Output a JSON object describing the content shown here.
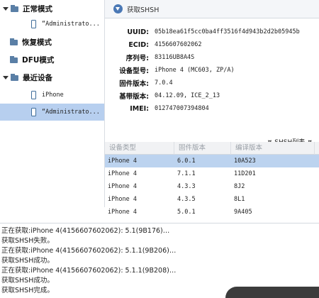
{
  "tree": {
    "items": [
      {
        "label": "正常模式",
        "kind": "folder"
      },
      {
        "label": "“Administrato...",
        "kind": "device"
      },
      {
        "label": "恢复模式",
        "kind": "folder"
      },
      {
        "label": "DFU模式",
        "kind": "folder"
      },
      {
        "label": "最近设备",
        "kind": "folder"
      },
      {
        "label": "iPhone",
        "kind": "device"
      },
      {
        "label": "“Administrato...",
        "kind": "device",
        "selected": true
      }
    ]
  },
  "toolbar": {
    "get_shsh_label": "获取SHSH"
  },
  "info": {
    "rows": [
      {
        "label": "UUID:",
        "value": "05b18ea61f5cc0ba4ff3516f4d943b2d2b05945b"
      },
      {
        "label": "ECID:",
        "value": "4156607602062"
      },
      {
        "label": "序列号:",
        "value": "83116UB8A4S"
      },
      {
        "label": "设备型号:",
        "value": "iPhone 4 (MC603, ZP/A)"
      },
      {
        "label": "固件版本:",
        "value": "7.0.4"
      },
      {
        "label": "基带版本:",
        "value": "04.12.09, ICE_2_13"
      },
      {
        "label": "IMEI:",
        "value": "012747007394804"
      }
    ],
    "shsh_list_label": "SHSH列表"
  },
  "table": {
    "columns": [
      "设备类型",
      "固件版本",
      "编译版本"
    ],
    "rows": [
      {
        "device": "iPhone 4",
        "firmware": "6.0.1",
        "build": "10A523",
        "selected": true
      },
      {
        "device": "iPhone 4",
        "firmware": "7.1.1",
        "build": "11D201"
      },
      {
        "device": "iPhone 4",
        "firmware": "4.3.3",
        "build": "8J2"
      },
      {
        "device": "iPhone 4",
        "firmware": "4.3.5",
        "build": "8L1"
      },
      {
        "device": "iPhone 4",
        "firmware": "5.0.1",
        "build": "9A405"
      }
    ]
  },
  "log": {
    "lines": [
      "正在获取:iPhone 4(4156607602062): 5.1(9B176)…",
      "获取SHSH失败。",
      "正在获取:iPhone 4(4156607602062): 5.1.1(9B206)…",
      "获取SHSH成功。",
      "正在获取:iPhone 4(4156607602062): 5.1.1(9B208)…",
      "获取SHSH成功。",
      "获取SHSH完成。"
    ]
  },
  "colors": {
    "selection": "#b7cfef",
    "accent": "#4a78b5"
  }
}
